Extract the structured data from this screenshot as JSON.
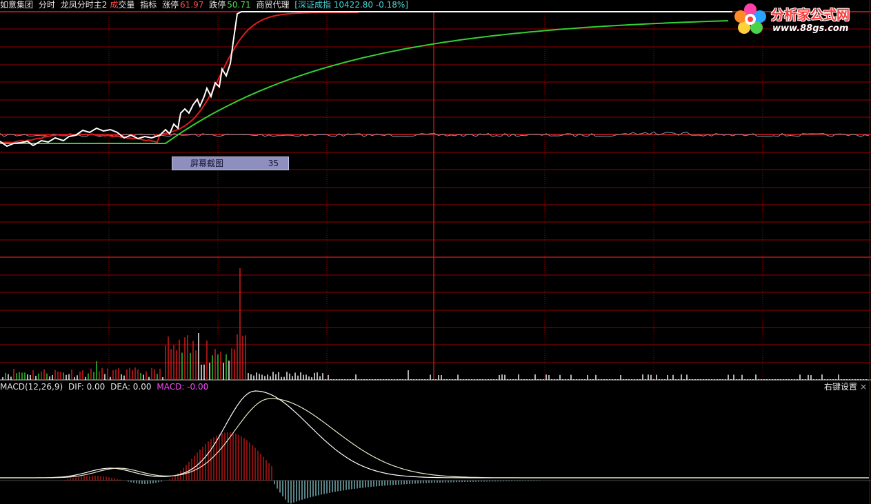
{
  "infobar": {
    "stock_name": "如意集团",
    "mode": "分时",
    "indicator_name": "龙凤分时主2",
    "volume_label_1": "成",
    "volume_label_2": "交量",
    "indicator_label": "指标",
    "limit_up_label": "涨停",
    "limit_up_value": "61.97",
    "limit_down_label": "跌停",
    "limit_down_value": "50.71",
    "sector": "商贸代理",
    "index_info": "[深证成指 10422.80 -0.18%]"
  },
  "macd_bar": {
    "name": "MACD(12,26,9)",
    "dif": "DIF: 0.00",
    "dea": "DEA: 0.00",
    "macd": "MACD: -0.00"
  },
  "right_settings": {
    "label": "右键设置",
    "close": "×"
  },
  "popup": {
    "label": "屏幕截图",
    "value": "35"
  },
  "logo": {
    "brand": "分析家公式网",
    "site": "www.88gs.com"
  },
  "colors": {
    "grid": "#9a0000",
    "ref_line": "#e01c1c",
    "price": "#ffffff",
    "ma_fast": "#e01c1c",
    "ma_slow": "#34d034",
    "avg": "#6f9bb0",
    "vol_up": "#e01c1c",
    "vol_down": "#ffffff",
    "vol_green": "#34d034",
    "macd_pos": "#e01c1c",
    "macd_neg": "#8fd8e0"
  }
}
